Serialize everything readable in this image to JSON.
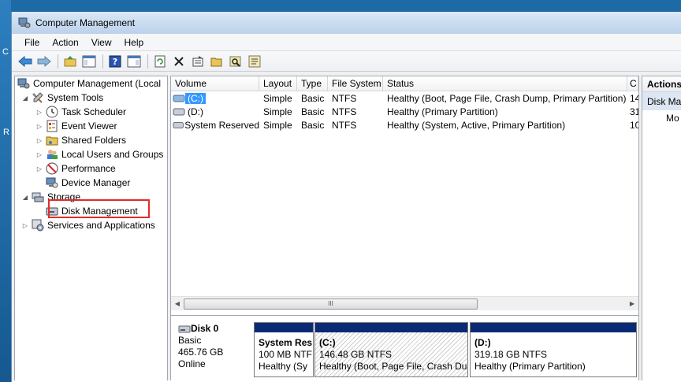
{
  "desktop": {
    "glyph1": "C",
    "glyph2": "R"
  },
  "window": {
    "title": "Computer Management"
  },
  "menu": [
    "File",
    "Action",
    "View",
    "Help"
  ],
  "toolbar": [
    "back-icon",
    "forward-icon",
    "up-folder-icon",
    "show-hide-tree-icon",
    "help-icon",
    "show-hide-action-pane-icon",
    "refresh-icon",
    "delete-icon",
    "properties-icon",
    "open-icon",
    "search-icon",
    "settings-icon"
  ],
  "tree": {
    "root": "Computer Management (Local",
    "system_tools": "System Tools",
    "task_scheduler": "Task Scheduler",
    "event_viewer": "Event Viewer",
    "shared_folders": "Shared Folders",
    "local_users": "Local Users and Groups",
    "performance": "Performance",
    "device_manager": "Device Manager",
    "storage": "Storage",
    "disk_management": "Disk Management",
    "services": "Services and Applications"
  },
  "volumes": {
    "headers": [
      "Volume",
      "Layout",
      "Type",
      "File System",
      "Status",
      "C"
    ],
    "rows": [
      {
        "volume": "(C:)",
        "layout": "Simple",
        "type": "Basic",
        "fs": "NTFS",
        "status": "Healthy (Boot, Page File, Crash Dump, Primary Partition)",
        "cap": "14"
      },
      {
        "volume": "(D:)",
        "layout": "Simple",
        "type": "Basic",
        "fs": "NTFS",
        "status": "Healthy (Primary Partition)",
        "cap": "31"
      },
      {
        "volume": "System Reserved",
        "layout": "Simple",
        "type": "Basic",
        "fs": "NTFS",
        "status": "Healthy (System, Active, Primary Partition)",
        "cap": "10"
      }
    ]
  },
  "disk": {
    "name": "Disk 0",
    "type": "Basic",
    "size": "465.76 GB",
    "state": "Online",
    "partitions": [
      {
        "name": "System Res",
        "size": "100 MB NTF",
        "status": "Healthy (Sy"
      },
      {
        "name": "(C:)",
        "size": "146.48 GB NTFS",
        "status": "Healthy (Boot, Page File, Crash Dur"
      },
      {
        "name": "(D:)",
        "size": "319.18 GB NTFS",
        "status": "Healthy (Primary Partition)"
      }
    ]
  },
  "actions": {
    "header": "Actions",
    "sub": "Disk Ma",
    "item": "Mo"
  },
  "scrollbar": {
    "grip": "III"
  }
}
